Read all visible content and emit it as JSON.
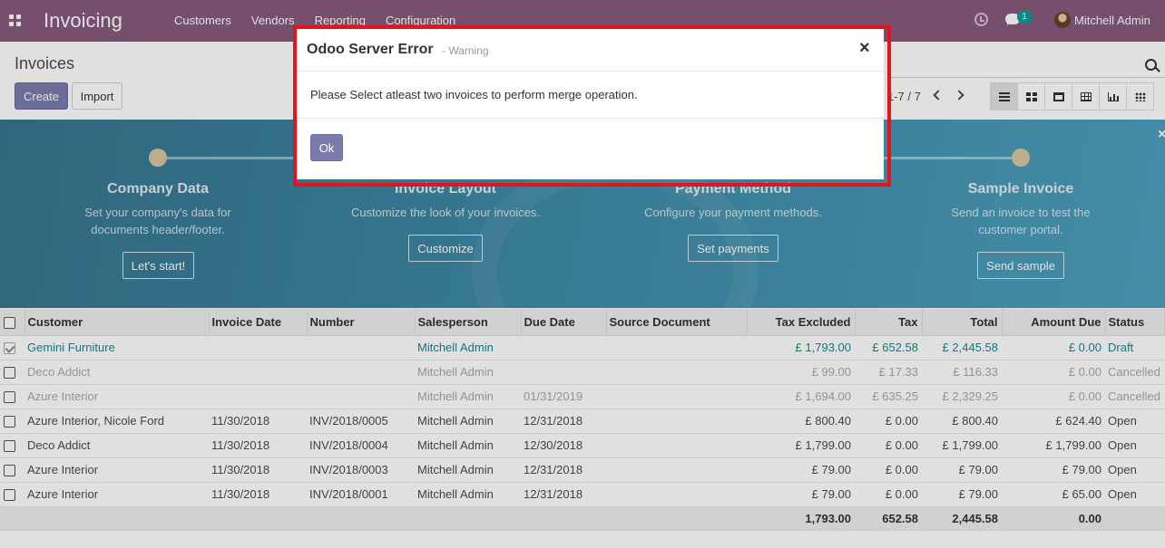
{
  "navbar": {
    "app_title": "Invoicing",
    "menu": [
      "Customers",
      "Vendors",
      "Reporting",
      "Configuration"
    ],
    "notification_count": "1",
    "user_name": "Mitchell Admin",
    "brand_color": "#875a7b"
  },
  "control_panel": {
    "breadcrumb": "Invoices",
    "create_label": "Create",
    "import_label": "Import",
    "pager": "1-7 / 7",
    "views": [
      "list-icon",
      "kanban-icon",
      "calendar-icon",
      "pivot-icon",
      "graph-icon",
      "grid-icon"
    ],
    "active_view": "list"
  },
  "onboarding": {
    "steps": [
      {
        "title": "Company Data",
        "desc": "Set your company's data for documents header/footer.",
        "button": "Let's start!"
      },
      {
        "title": "Invoice Layout",
        "desc": "Customize the look of your invoices.",
        "button": "Customize"
      },
      {
        "title": "Payment Method",
        "desc": "Configure your payment methods.",
        "button": "Set payments"
      },
      {
        "title": "Sample Invoice",
        "desc": "Send an invoice to test the customer portal.",
        "button": "Send sample"
      }
    ]
  },
  "table": {
    "headers": [
      "Customer",
      "Invoice Date",
      "Number",
      "Salesperson",
      "Due Date",
      "Source Document",
      "Tax Excluded",
      "Tax",
      "Total",
      "Amount Due",
      "Status"
    ],
    "rows": [
      {
        "checked": true,
        "state": "draft",
        "customer": "Gemini Furniture",
        "invoice_date": "",
        "number": "",
        "salesperson": "Mitchell Admin",
        "due_date": "",
        "source": "",
        "tax_excluded": "£ 1,793.00",
        "tax": "£ 652.58",
        "total": "£ 2,445.58",
        "amount_due": "£ 0.00",
        "status": "Draft"
      },
      {
        "checked": false,
        "state": "cancelled",
        "customer": "Deco Addict",
        "invoice_date": "",
        "number": "",
        "salesperson": "Mitchell Admin",
        "due_date": "",
        "source": "",
        "tax_excluded": "£ 99.00",
        "tax": "£ 17.33",
        "total": "£ 116.33",
        "amount_due": "£ 0.00",
        "status": "Cancelled"
      },
      {
        "checked": false,
        "state": "cancelled",
        "customer": "Azure Interior",
        "invoice_date": "",
        "number": "",
        "salesperson": "Mitchell Admin",
        "due_date": "01/31/2019",
        "source": "",
        "tax_excluded": "£ 1,694.00",
        "tax": "£ 635.25",
        "total": "£ 2,329.25",
        "amount_due": "£ 0.00",
        "status": "Cancelled"
      },
      {
        "checked": false,
        "state": "open",
        "customer": "Azure Interior, Nicole Ford",
        "invoice_date": "11/30/2018",
        "number": "INV/2018/0005",
        "salesperson": "Mitchell Admin",
        "due_date": "12/31/2018",
        "source": "",
        "tax_excluded": "£ 800.40",
        "tax": "£ 0.00",
        "total": "£ 800.40",
        "amount_due": "£ 624.40",
        "status": "Open"
      },
      {
        "checked": false,
        "state": "open",
        "customer": "Deco Addict",
        "invoice_date": "11/30/2018",
        "number": "INV/2018/0004",
        "salesperson": "Mitchell Admin",
        "due_date": "12/30/2018",
        "source": "",
        "tax_excluded": "£ 1,799.00",
        "tax": "£ 0.00",
        "total": "£ 1,799.00",
        "amount_due": "£ 1,799.00",
        "status": "Open"
      },
      {
        "checked": false,
        "state": "open",
        "customer": "Azure Interior",
        "invoice_date": "11/30/2018",
        "number": "INV/2018/0003",
        "salesperson": "Mitchell Admin",
        "due_date": "12/31/2018",
        "source": "",
        "tax_excluded": "£ 79.00",
        "tax": "£ 0.00",
        "total": "£ 79.00",
        "amount_due": "£ 79.00",
        "status": "Open"
      },
      {
        "checked": false,
        "state": "open",
        "customer": "Azure Interior",
        "invoice_date": "11/30/2018",
        "number": "INV/2018/0001",
        "salesperson": "Mitchell Admin",
        "due_date": "12/31/2018",
        "source": "",
        "tax_excluded": "£ 79.00",
        "tax": "£ 0.00",
        "total": "£ 79.00",
        "amount_due": "£ 65.00",
        "status": "Open"
      }
    ],
    "totals": {
      "tax_excluded": "1,793.00",
      "tax": "652.58",
      "total": "2,445.58",
      "amount_due": "0.00"
    }
  },
  "dialog": {
    "title": "Odoo Server Error",
    "subtitle": "- Warning",
    "close_glyph": "×",
    "message": "Please Select atleast two invoices to perform merge operation.",
    "ok_label": "Ok",
    "highlight_color": "#e8121b"
  }
}
